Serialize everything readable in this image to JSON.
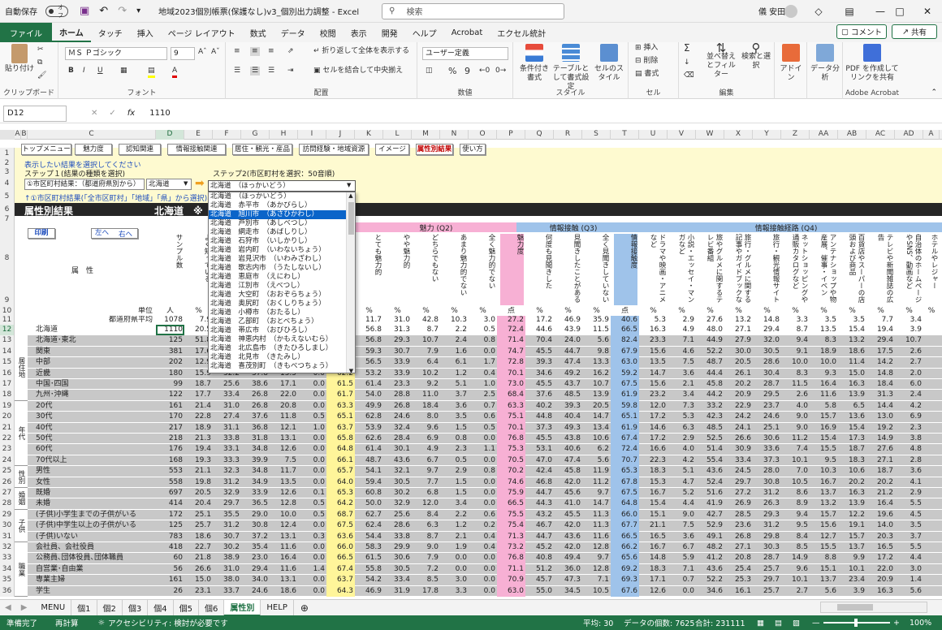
{
  "titlebar": {
    "autosave": "自動保存",
    "toggle": "オフ",
    "filename": "地域2023個別帳票(保護なし)v3_個別出力調整 - Excel",
    "search": "検索",
    "user": "儀 安田"
  },
  "ribbon_tabs": [
    "ファイル",
    "ホーム",
    "タッチ",
    "挿入",
    "ページ レイアウト",
    "数式",
    "データ",
    "校閲",
    "表示",
    "開発",
    "ヘルプ",
    "Acrobat",
    "エクセル統計"
  ],
  "ribbon_right": {
    "comment": "コメント",
    "share": "共有"
  },
  "ribbon": {
    "paste": "貼り付け",
    "clipboard": "クリップボード",
    "font_name": "ＭＳ Ｐゴシック",
    "font_size": "9",
    "font": "フォント",
    "wrap": "折り返して全体を表示する",
    "merge": "セルを結合して中央揃え",
    "alignment": "配置",
    "numfmt": "ユーザー定義",
    "number": "数値",
    "cond": "条件付き書式",
    "table": "テーブルとして書式設定",
    "cellstyle": "セルのスタイル",
    "style": "スタイル",
    "insert": "挿入",
    "delete": "削除",
    "format": "書式",
    "cells": "セル",
    "sort": "並べ替えとフィルター",
    "find": "検索と選択",
    "editing": "編集",
    "addin": "アドイン",
    "analysis": "データ分析",
    "pdf": "PDF を作成してリンクを共有",
    "acrobat": "Adobe Acrobat"
  },
  "formula": {
    "namebox": "D12",
    "fx": "fx",
    "value": "1110"
  },
  "columns": [
    "A",
    "B",
    "C",
    "D",
    "E",
    "F",
    "G",
    "H",
    "I",
    "J",
    "K",
    "L",
    "M",
    "N",
    "O",
    "P",
    "Q",
    "R",
    "S",
    "T",
    "U",
    "V",
    "W",
    "X",
    "Y",
    "Z",
    "AA",
    "AB",
    "AC",
    "AD",
    "A"
  ],
  "nav_buttons": [
    "トップメニュー",
    "魅力度",
    "認知関連",
    "情報接触関連",
    "居住・観光・産品",
    "訪問経験・地域資源",
    "イメージ",
    "属性別結果",
    "使い方"
  ],
  "sheet": {
    "r2": "表示したい結果を選択してください",
    "r3": "ステップ１(結果の種類を選択)",
    "step2": "ステップ2(市区町村を選択：50音順)",
    "r4_label": "①市区町村結果：（都道府県別から）",
    "r4_pref": "北海道",
    "r4_city": "北海道　（ほっかいどう）",
    "r5": "↑①市区町村結果(「全市区町村」「地域」「県」から選択)、ぐ",
    "r6_title": "属性別結果",
    "r6_region": "北海道　※",
    "print": "印刷",
    "left": "左へ",
    "right": "右へ",
    "attr": "属　性",
    "unit_label": "単位",
    "avg_label": "都道府県平均",
    "q2": "魅力 (Q2)",
    "q3": "情報接触 (Q3)",
    "q4": "情報接触経路 (Q4)",
    "sample": "サンプル数",
    "e_hdr": "よく知っている",
    "k_hdr": "とても魅力的",
    "l_hdr": "やや魅力的",
    "m_hdr": "どちらでもない",
    "n_hdr": "あまり魅力的でない",
    "o_hdr": "全く魅力的でない",
    "p_hdr": "魅力度",
    "q_hdr": "何度も見聞きした",
    "r_hdr": "見聞きしたことがある",
    "s_hdr": "全く見聞きしていない",
    "t_hdr": "情報接触度",
    "u_hdr": "ドラマや映画・アニメなど",
    "v_hdr": "小説・エッセイ・マンガなど",
    "w_hdr": "旅やグルメに関するテレビ番組",
    "x_hdr": "旅行・グルメに関する記事やガイドブックな",
    "y_hdr": "旅行・観光情報サイト",
    "z_hdr": "ネットショッピングや通販カタログなど",
    "aa_hdr": "アンテナショップや物産展、催事・イベン",
    "ab_hdr": "百貨店やスーパーの店頭および商品",
    "ac_hdr": "テレビや新聞雑誌の広告",
    "ad_hdr": "自治体のホームページやSNS、動画など",
    "ae_hdr": "ホテルやレジャー",
    "units": [
      "人",
      "%",
      "",
      "",
      "",
      "",
      "",
      "%",
      "%",
      "%",
      "%",
      "%",
      "点",
      "%",
      "%",
      "%",
      "点",
      "%",
      "%",
      "%",
      "%",
      "%",
      "%",
      "%",
      "%",
      "%",
      "%",
      "%"
    ],
    "avg": [
      "1078",
      "7.9",
      "",
      "",
      "",
      "",
      "",
      "11.7",
      "31.0",
      "42.8",
      "10.3",
      "3.0",
      "27.2",
      "17.2",
      "46.9",
      "35.9",
      "40.6",
      "5.3",
      "2.9",
      "27.6",
      "13.2",
      "14.8",
      "3.3",
      "3.5",
      "3.5",
      "7.7",
      "3.4"
    ]
  },
  "row_groups": [
    {
      "label": "居住地",
      "from": 13,
      "to": 18
    },
    {
      "label": "年代",
      "from": 19,
      "to": 24
    },
    {
      "label": "性別",
      "from": 25,
      "to": 26
    },
    {
      "label": "婚姻",
      "from": 27,
      "to": 28
    },
    {
      "label": "子供",
      "from": 29,
      "to": 31
    },
    {
      "label": "職業",
      "from": 32,
      "to": 36
    }
  ],
  "rows": [
    {
      "n": 12,
      "label": "北海道",
      "d": "1110",
      "e": "20.5",
      "f": "",
      "g": "",
      "h": "",
      "i": "",
      "j": "",
      "k": "56.8",
      "l": "31.3",
      "m": "8.7",
      "nn": "2.2",
      "o": "0.5",
      "p": "72.4",
      "q": "44.6",
      "r": "43.9",
      "s": "11.5",
      "t": "66.5",
      "u": "16.3",
      "v": "4.9",
      "w": "48.0",
      "x": "27.1",
      "y": "29.4",
      "z": "8.7",
      "aa": "13.5",
      "ab": "15.4",
      "ac": "19.4",
      "ad": "3.9"
    },
    {
      "n": 13,
      "label": "北海道･東北",
      "d": "125",
      "e": "51.8",
      "f": "",
      "g": "",
      "h": "",
      "i": "",
      "j": "",
      "k": "56.8",
      "l": "29.3",
      "m": "10.7",
      "nn": "2.4",
      "o": "0.8",
      "p": "71.4",
      "q": "70.4",
      "r": "24.0",
      "s": "5.6",
      "t": "82.4",
      "u": "23.3",
      "v": "7.1",
      "w": "44.9",
      "x": "27.9",
      "y": "32.0",
      "z": "9.4",
      "aa": "8.3",
      "ab": "13.2",
      "ac": "29.4",
      "ad": "10.7"
    },
    {
      "n": 14,
      "label": "関東",
      "d": "381",
      "e": "17.6",
      "f": "",
      "g": "",
      "h": "",
      "i": "",
      "j": "",
      "k": "59.3",
      "l": "30.7",
      "m": "7.9",
      "nn": "1.6",
      "o": "0.0",
      "p": "74.7",
      "q": "45.5",
      "r": "44.7",
      "s": "9.8",
      "t": "67.9",
      "u": "15.6",
      "v": "4.6",
      "w": "52.2",
      "x": "30.0",
      "y": "30.5",
      "z": "9.1",
      "aa": "18.9",
      "ab": "18.6",
      "ac": "17.5",
      "ad": "2.6"
    },
    {
      "n": 15,
      "label": "中部",
      "d": "202",
      "e": "12.9",
      "f": "",
      "g": "",
      "h": "",
      "i": "",
      "j": "",
      "k": "56.5",
      "l": "33.9",
      "m": "6.4",
      "nn": "6.1",
      "o": "1.7",
      "p": "72.8",
      "q": "39.3",
      "r": "47.4",
      "s": "13.3",
      "t": "63.0",
      "u": "13.5",
      "v": "7.5",
      "w": "48.7",
      "x": "20.5",
      "y": "28.6",
      "z": "10.0",
      "aa": "10.0",
      "ab": "11.4",
      "ac": "14.2",
      "ad": "2.7"
    },
    {
      "n": 16,
      "label": "近畿",
      "d": "180",
      "e": "15.9",
      "f": "32.2",
      "g": "37.8",
      "h": "13.5",
      "i": "0.0",
      "j": "62.2",
      "k": "53.2",
      "l": "33.9",
      "m": "10.2",
      "nn": "1.2",
      "o": "0.4",
      "p": "70.1",
      "q": "34.6",
      "r": "49.2",
      "s": "16.2",
      "t": "59.2",
      "u": "14.7",
      "v": "3.6",
      "w": "44.4",
      "x": "26.1",
      "y": "30.4",
      "z": "8.3",
      "aa": "9.3",
      "ab": "15.0",
      "ac": "14.8",
      "ad": "2.0"
    },
    {
      "n": 17,
      "label": "中国･四国",
      "d": "99",
      "e": "18.7",
      "f": "25.6",
      "g": "38.6",
      "h": "17.1",
      "i": "0.0",
      "j": "61.5",
      "k": "61.4",
      "l": "23.3",
      "m": "9.2",
      "nn": "5.1",
      "o": "1.0",
      "p": "73.0",
      "q": "45.5",
      "r": "43.7",
      "s": "10.7",
      "t": "67.5",
      "u": "15.6",
      "v": "2.1",
      "w": "45.8",
      "x": "20.2",
      "y": "28.7",
      "z": "11.5",
      "aa": "16.4",
      "ab": "16.3",
      "ac": "18.4",
      "ad": "6.0"
    },
    {
      "n": 18,
      "label": "九州･沖縄",
      "d": "122",
      "e": "17.7",
      "f": "33.4",
      "g": "26.8",
      "h": "22.0",
      "i": "0.0",
      "j": "61.7",
      "k": "54.0",
      "l": "28.8",
      "m": "11.0",
      "nn": "3.7",
      "o": "2.5",
      "p": "68.4",
      "q": "37.6",
      "r": "48.5",
      "s": "13.9",
      "t": "61.9",
      "u": "23.2",
      "v": "3.4",
      "w": "44.2",
      "x": "20.9",
      "y": "29.5",
      "z": "2.6",
      "aa": "11.6",
      "ab": "13.9",
      "ac": "31.3",
      "ad": "2.4"
    },
    {
      "n": 19,
      "label": "20代",
      "d": "161",
      "e": "21.4",
      "f": "31.0",
      "g": "26.8",
      "h": "20.8",
      "i": "0.0",
      "j": "63.3",
      "k": "49.9",
      "l": "26.8",
      "m": "18.4",
      "nn": "3.6",
      "o": "0.7",
      "p": "63.3",
      "q": "40.2",
      "r": "39.3",
      "s": "20.5",
      "t": "59.8",
      "u": "12.0",
      "v": "7.3",
      "w": "33.2",
      "x": "22.9",
      "y": "23.7",
      "z": "4.0",
      "aa": "5.8",
      "ab": "6.5",
      "ac": "14.4",
      "ad": "4.2"
    },
    {
      "n": 20,
      "label": "30代",
      "d": "170",
      "e": "22.8",
      "f": "27.4",
      "g": "37.6",
      "h": "11.8",
      "i": "0.5",
      "j": "65.1",
      "k": "62.8",
      "l": "24.6",
      "m": "8.0",
      "nn": "3.5",
      "o": "0.6",
      "p": "75.1",
      "q": "44.8",
      "r": "40.4",
      "s": "14.7",
      "t": "65.1",
      "u": "17.2",
      "v": "5.3",
      "w": "42.3",
      "x": "24.2",
      "y": "24.6",
      "z": "9.0",
      "aa": "15.7",
      "ab": "13.6",
      "ac": "13.0",
      "ad": "6.9"
    },
    {
      "n": 21,
      "label": "40代",
      "d": "217",
      "e": "18.9",
      "f": "31.1",
      "g": "36.8",
      "h": "12.1",
      "i": "1.0",
      "j": "63.7",
      "k": "53.9",
      "l": "32.4",
      "m": "9.6",
      "nn": "1.5",
      "o": "0.5",
      "p": "70.1",
      "q": "37.3",
      "r": "49.3",
      "s": "13.4",
      "t": "61.9",
      "u": "14.6",
      "v": "6.3",
      "w": "48.5",
      "x": "24.1",
      "y": "25.1",
      "z": "9.0",
      "aa": "16.9",
      "ab": "15.4",
      "ac": "19.2",
      "ad": "2.3"
    },
    {
      "n": 22,
      "label": "50代",
      "d": "218",
      "e": "21.3",
      "f": "33.8",
      "g": "31.8",
      "h": "13.1",
      "i": "0.0",
      "j": "65.8",
      "k": "62.6",
      "l": "28.4",
      "m": "6.9",
      "nn": "0.8",
      "o": "0.0",
      "p": "76.8",
      "q": "45.5",
      "r": "43.8",
      "s": "10.6",
      "t": "67.4",
      "u": "17.2",
      "v": "2.9",
      "w": "52.5",
      "x": "26.6",
      "y": "30.6",
      "z": "11.2",
      "aa": "15.4",
      "ab": "17.3",
      "ac": "14.9",
      "ad": "3.8"
    },
    {
      "n": 23,
      "label": "60代",
      "d": "176",
      "e": "19.4",
      "f": "33.1",
      "g": "34.8",
      "h": "12.6",
      "i": "0.0",
      "j": "64.8",
      "k": "61.4",
      "l": "30.1",
      "m": "4.9",
      "nn": "2.3",
      "o": "1.1",
      "p": "75.3",
      "q": "53.1",
      "r": "40.6",
      "s": "6.2",
      "t": "72.4",
      "u": "16.6",
      "v": "4.0",
      "w": "51.4",
      "x": "30.9",
      "y": "33.6",
      "z": "7.4",
      "aa": "15.5",
      "ab": "18.7",
      "ac": "27.6",
      "ad": "4.8"
    },
    {
      "n": 24,
      "label": "70代以上",
      "d": "168",
      "e": "19.3",
      "f": "33.3",
      "g": "39.9",
      "h": "7.5",
      "i": "0.0",
      "j": "66.1",
      "k": "48.7",
      "l": "43.6",
      "m": "6.7",
      "nn": "0.5",
      "o": "0.0",
      "p": "70.5",
      "q": "47.0",
      "r": "47.4",
      "s": "5.6",
      "t": "70.7",
      "u": "22.3",
      "v": "4.2",
      "w": "55.4",
      "x": "33.4",
      "y": "37.3",
      "z": "10.1",
      "aa": "9.5",
      "ab": "18.3",
      "ac": "27.1",
      "ad": "2.8"
    },
    {
      "n": 25,
      "label": "男性",
      "d": "553",
      "e": "21.1",
      "f": "32.3",
      "g": "34.8",
      "h": "11.7",
      "i": "0.0",
      "j": "65.7",
      "k": "54.1",
      "l": "32.1",
      "m": "9.7",
      "nn": "2.9",
      "o": "0.8",
      "p": "70.2",
      "q": "42.4",
      "r": "45.8",
      "s": "11.9",
      "t": "65.3",
      "u": "18.3",
      "v": "5.1",
      "w": "43.6",
      "x": "24.5",
      "y": "28.0",
      "z": "7.0",
      "aa": "10.3",
      "ab": "10.6",
      "ac": "18.7",
      "ad": "3.6"
    },
    {
      "n": 26,
      "label": "女性",
      "d": "558",
      "e": "19.8",
      "f": "31.2",
      "g": "34.9",
      "h": "13.5",
      "i": "0.0",
      "j": "64.0",
      "k": "59.4",
      "l": "30.5",
      "m": "7.7",
      "nn": "1.5",
      "o": "0.0",
      "p": "74.6",
      "q": "46.8",
      "r": "42.0",
      "s": "11.2",
      "t": "67.8",
      "u": "15.3",
      "v": "4.7",
      "w": "52.4",
      "x": "29.7",
      "y": "30.8",
      "z": "10.5",
      "aa": "16.7",
      "ab": "20.2",
      "ac": "20.2",
      "ad": "4.1"
    },
    {
      "n": 27,
      "label": "既婚",
      "d": "697",
      "e": "20.5",
      "f": "32.9",
      "g": "33.9",
      "h": "12.6",
      "i": "0.1",
      "j": "65.3",
      "k": "60.8",
      "l": "30.2",
      "m": "6.8",
      "nn": "1.5",
      "o": "0.0",
      "p": "75.9",
      "q": "44.7",
      "r": "45.6",
      "s": "9.7",
      "t": "67.5",
      "u": "16.7",
      "v": "5.2",
      "w": "51.6",
      "x": "27.2",
      "y": "31.2",
      "z": "8.6",
      "aa": "13.7",
      "ab": "16.3",
      "ac": "21.2",
      "ad": "2.9"
    },
    {
      "n": 28,
      "label": "未婚",
      "d": "414",
      "e": "20.4",
      "f": "29.7",
      "g": "36.5",
      "h": "12.8",
      "i": "0.5",
      "j": "64.2",
      "k": "50.0",
      "l": "32.9",
      "m": "12.0",
      "nn": "3.4",
      "o": "0.0",
      "p": "66.5",
      "q": "44.3",
      "r": "41.0",
      "s": "14.7",
      "t": "64.8",
      "u": "15.4",
      "v": "4.4",
      "w": "41.9",
      "x": "26.9",
      "y": "26.3",
      "z": "8.9",
      "aa": "13.2",
      "ab": "13.9",
      "ac": "16.4",
      "ad": "5.5"
    },
    {
      "n": 29,
      "label": "(子供)小学生までの子供がいる",
      "d": "172",
      "e": "25.1",
      "f": "35.5",
      "g": "29.0",
      "h": "10.0",
      "i": "0.5",
      "j": "68.7",
      "k": "62.7",
      "l": "25.6",
      "m": "8.4",
      "nn": "2.2",
      "o": "0.6",
      "p": "75.5",
      "q": "43.2",
      "r": "45.5",
      "s": "11.3",
      "t": "66.0",
      "u": "15.1",
      "v": "9.0",
      "w": "42.7",
      "x": "28.5",
      "y": "29.3",
      "z": "9.4",
      "aa": "15.7",
      "ab": "12.2",
      "ac": "19.6",
      "ad": "4.5"
    },
    {
      "n": 30,
      "label": "(子供)中学生以上の子供がいる",
      "d": "125",
      "e": "25.7",
      "f": "31.2",
      "g": "30.8",
      "h": "12.4",
      "i": "0.0",
      "j": "67.5",
      "k": "62.4",
      "l": "28.6",
      "m": "6.3",
      "nn": "1.2",
      "o": "0.2",
      "p": "75.4",
      "q": "46.7",
      "r": "42.0",
      "s": "11.3",
      "t": "67.7",
      "u": "21.1",
      "v": "7.5",
      "w": "52.9",
      "x": "23.6",
      "y": "31.2",
      "z": "9.5",
      "aa": "15.6",
      "ab": "19.1",
      "ac": "14.0",
      "ad": "3.5"
    },
    {
      "n": 31,
      "label": "(子供)いない",
      "d": "783",
      "e": "18.6",
      "f": "30.7",
      "g": "37.2",
      "h": "13.1",
      "i": "0.3",
      "j": "63.6",
      "k": "54.4",
      "l": "33.8",
      "m": "8.7",
      "nn": "2.1",
      "o": "0.4",
      "p": "71.3",
      "q": "44.7",
      "r": "43.6",
      "s": "11.6",
      "t": "66.5",
      "u": "16.5",
      "v": "3.6",
      "w": "49.1",
      "x": "26.8",
      "y": "29.8",
      "z": "8.4",
      "aa": "12.7",
      "ab": "15.7",
      "ac": "20.3",
      "ad": "3.7"
    },
    {
      "n": 32,
      "label": "会社員、会社役員",
      "d": "418",
      "e": "22.7",
      "f": "30.2",
      "g": "35.4",
      "h": "11.6",
      "i": "0.0",
      "j": "66.0",
      "k": "58.3",
      "l": "29.9",
      "m": "9.0",
      "nn": "1.9",
      "o": "0.4",
      "p": "73.2",
      "q": "45.2",
      "r": "42.0",
      "s": "12.8",
      "t": "66.2",
      "u": "16.7",
      "v": "6.7",
      "w": "48.2",
      "x": "27.1",
      "y": "30.3",
      "z": "8.5",
      "aa": "15.5",
      "ab": "13.7",
      "ac": "16.5",
      "ad": "5.5"
    },
    {
      "n": 33,
      "label": "公務員､団体役員､団体職員",
      "d": "60",
      "e": "21.8",
      "f": "38.9",
      "g": "23.0",
      "h": "16.4",
      "i": "0.0",
      "j": "66.5",
      "k": "61.5",
      "l": "30.6",
      "m": "7.9",
      "nn": "0.0",
      "o": "0.0",
      "p": "76.8",
      "q": "40.8",
      "r": "49.4",
      "s": "9.7",
      "t": "65.6",
      "u": "14.8",
      "v": "5.9",
      "w": "41.2",
      "x": "20.8",
      "y": "28.7",
      "z": "14.9",
      "aa": "8.8",
      "ab": "9.9",
      "ac": "17.2",
      "ad": "4.4"
    },
    {
      "n": 34,
      "label": "自営業･自由業",
      "d": "56",
      "e": "26.6",
      "f": "31.0",
      "g": "29.4",
      "h": "11.6",
      "i": "1.4",
      "j": "67.4",
      "k": "55.8",
      "l": "30.5",
      "m": "7.2",
      "nn": "0.0",
      "o": "0.0",
      "p": "71.1",
      "q": "51.2",
      "r": "36.0",
      "s": "12.8",
      "t": "69.2",
      "u": "18.3",
      "v": "7.1",
      "w": "43.6",
      "x": "25.4",
      "y": "25.7",
      "z": "9.6",
      "aa": "15.1",
      "ab": "10.1",
      "ac": "22.0",
      "ad": "3.0"
    },
    {
      "n": 35,
      "label": "専業主婦",
      "d": "161",
      "e": "15.0",
      "f": "38.0",
      "g": "34.0",
      "h": "13.1",
      "i": "0.0",
      "j": "63.7",
      "k": "54.2",
      "l": "33.4",
      "m": "8.5",
      "nn": "3.0",
      "o": "0.0",
      "p": "70.9",
      "q": "45.7",
      "r": "47.3",
      "s": "7.1",
      "t": "69.3",
      "u": "17.1",
      "v": "0.7",
      "w": "52.2",
      "x": "25.3",
      "y": "29.7",
      "z": "10.1",
      "aa": "13.7",
      "ab": "23.4",
      "ac": "20.9",
      "ad": "1.4"
    },
    {
      "n": 36,
      "label": "学生",
      "d": "26",
      "e": "23.1",
      "f": "33.7",
      "g": "24.6",
      "h": "18.6",
      "i": "0.0",
      "j": "64.3",
      "k": "46.9",
      "l": "31.9",
      "m": "17.8",
      "nn": "3.3",
      "o": "0.0",
      "p": "63.0",
      "q": "55.0",
      "r": "34.5",
      "s": "10.5",
      "t": "67.6",
      "u": "12.6",
      "v": "0.0",
      "w": "34.6",
      "x": "16.1",
      "y": "25.7",
      "z": "2.7",
      "aa": "5.6",
      "ab": "3.9",
      "ac": "16.3",
      "ad": "5.6"
    }
  ],
  "dropdown": [
    "北海道　（ほっかいどう）",
    "北海道　赤平市　（あかびらし）",
    "北海道　旭川市　（あさひかわし）",
    "北海道　芦別市　（あしべつし）",
    "北海道　網走市　（あばしりし）",
    "北海道　石狩市　（いしかりし）",
    "北海道　岩内町　（いわないちょう）",
    "北海道　岩見沢市　（いわみざわし）",
    "北海道　歌志内市　（うたしないし）",
    "北海道　恵庭市　（えにわし）",
    "北海道　江別市　（えべつし）",
    "北海道　大空町　（おおぞらちょう）",
    "北海道　奥尻町　（おくしりちょう）",
    "北海道　小樽市　（おたるし）",
    "北海道　乙部町　（おとべちょう）",
    "北海道　帯広市　（おびひろし）",
    "北海道　神恵内村　（かもえないむら）",
    "北海道　北広島市　（きたひろしまし）",
    "北海道　北見市　（きたみし）",
    "北海道　喜茂別町　（きもべつちょう）"
  ],
  "sheet_tabs": [
    "MENU",
    "個1",
    "個2",
    "個3",
    "個4",
    "個5",
    "個6",
    "属性別",
    "HELP"
  ],
  "status": {
    "ready": "準備完了",
    "recalc": "再計算",
    "access": "アクセシビリティ: 検討が必要です",
    "avg": "平均: 30",
    "count": "データの個数: 7625",
    "sum": "合計: 231111",
    "zoom": "100%"
  },
  "colors": {
    "excel_green": "#217346",
    "pink": "#f7b0d4",
    "blue": "#9fc3ea",
    "yellow": "#fefad0",
    "gray": "#d6d6d6",
    "row_gray": "#c8c8c8",
    "header_dark": "#262626"
  }
}
